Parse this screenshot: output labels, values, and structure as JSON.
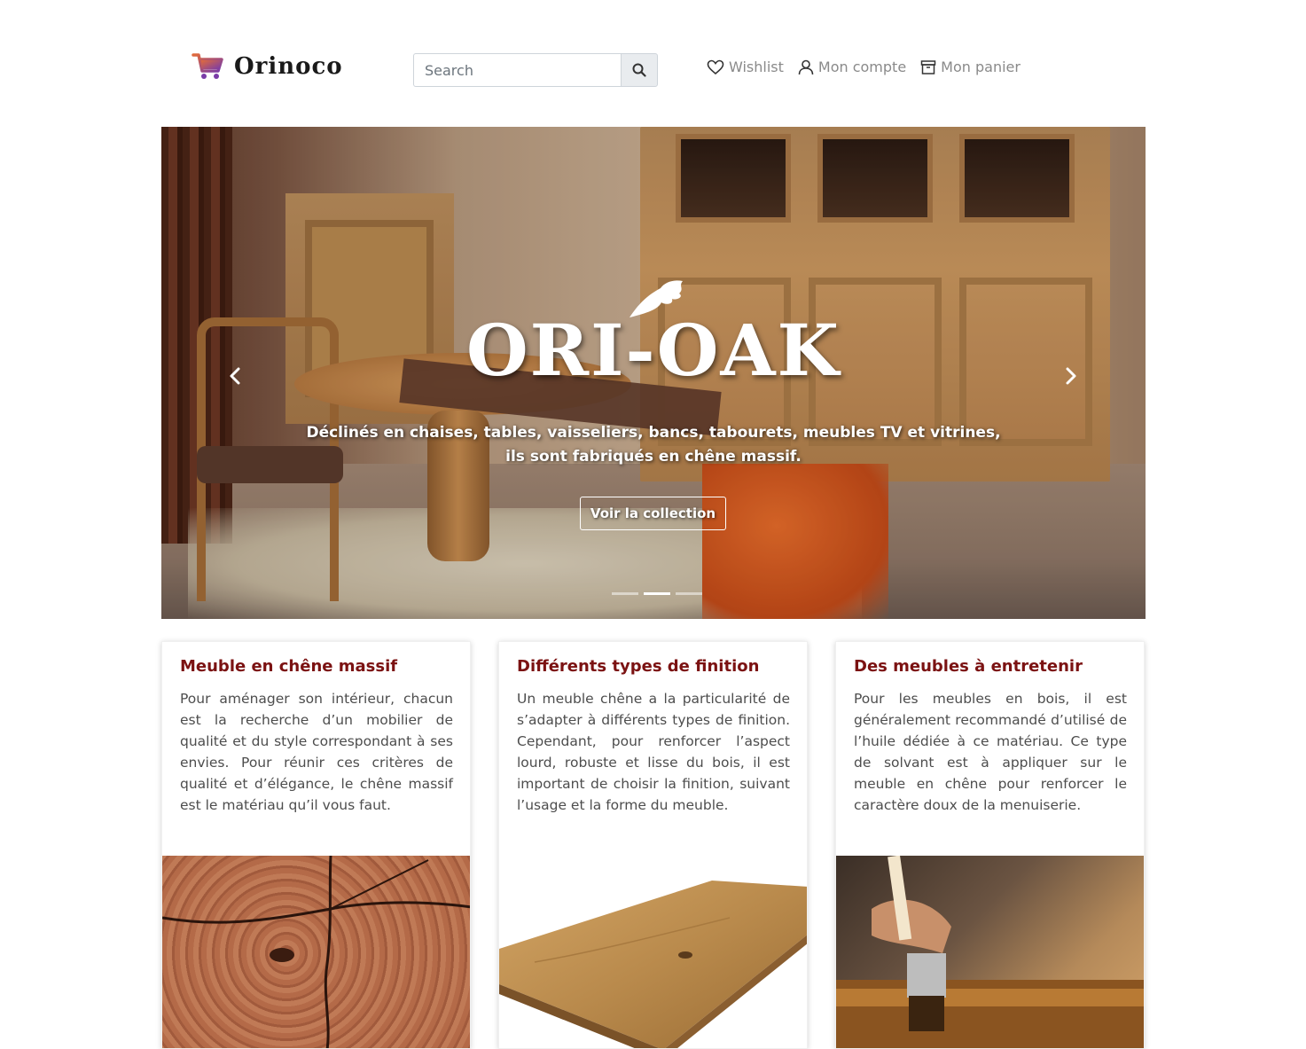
{
  "brand": {
    "name": "Orinoco",
    "icon": "cart-icon",
    "cart_color_start": "#e06a3c",
    "cart_color_end": "#7a3ca8"
  },
  "search": {
    "placeholder": "Search",
    "value": "",
    "button_icon": "search-icon"
  },
  "nav": {
    "items": [
      {
        "label": "Wishlist",
        "icon": "heart-icon"
      },
      {
        "label": "Mon compte",
        "icon": "user-icon"
      },
      {
        "label": "Mon panier",
        "icon": "box-icon"
      }
    ]
  },
  "hero": {
    "title": "ORI-OAK",
    "caption_line1": "Déclinés en chaises, tables, vaisseliers, bancs, tabourets, meubles TV et vitrines,",
    "caption_line2": "ils sont fabriqués en chêne massif.",
    "button_label": "Voir la collection",
    "slides": 3,
    "active_slide": 2,
    "prev_icon": "chevron-left-icon",
    "next_icon": "chevron-right-icon"
  },
  "cards": [
    {
      "title": "Meuble en chêne massif",
      "text": "Pour aménager son intérieur, chacun est la recherche d’un mobilier de qualité et du style correspondant à ses envies. Pour réunir ces critères de qualité et d’élégance, le chêne massif est le matériau qu’il vous faut.",
      "image": "oak-cross-section"
    },
    {
      "title": "Différents types de finition",
      "text": "Un meuble chêne a la particularité de s’adapter à différents types de finition. Cependant, pour renforcer l’aspect lourd, robuste et lisse du bois, il est important de choisir la finition, suivant l’usage et la forme du meuble.",
      "image": "oak-plank"
    },
    {
      "title": "Des meubles à entretenir",
      "text": "Pour les meubles en bois, il est généralement recommandé d’utilisé de l’huile dédiée à ce matériau. Ce type de solvant est à appliquer sur le meuble en chêne pour renforcer le caractère doux de la menuiserie.",
      "image": "brush-oiling-wood"
    }
  ],
  "colors": {
    "card_title": "#7b1212",
    "nav_text": "#8a8a8a",
    "body_text": "#4d4d4d"
  }
}
